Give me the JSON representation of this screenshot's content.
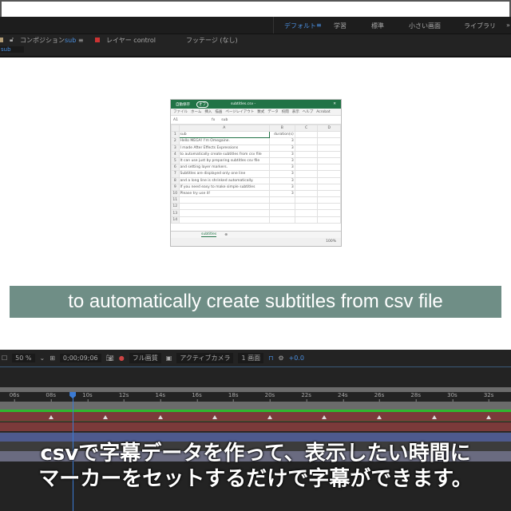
{
  "workspace": {
    "tabs": [
      "デフォルト",
      "学習",
      "標準",
      "小さい画面",
      "ライブラリ"
    ],
    "active": 0,
    "menu_icon": "≡",
    "more": "»"
  },
  "panels": {
    "composition_label": "コンポジション",
    "composition_name": "sub",
    "layer_label": "レイヤー control",
    "footage_label": "フッテージ (なし)",
    "menu_icon": "≡"
  },
  "breadcrumb": "sub",
  "excel": {
    "title": "subtitles.csv -",
    "autosave": "自動保存",
    "autosave_state": "オフ",
    "menu": [
      "ファイル",
      "ホーム",
      "挿入",
      "描画",
      "ページレイアウト",
      "数式",
      "データ",
      "校閲",
      "表示",
      "ヘルプ",
      "Acrobat"
    ],
    "cell_ref": "A1",
    "formula": "sub",
    "columns": [
      "A",
      "B",
      "C",
      "D"
    ],
    "rows": [
      [
        "sub",
        "duration(s)"
      ],
      [
        "Hello MEGA! I'm Omegaine.",
        "3"
      ],
      [
        "I made After Effects Expressions",
        "3"
      ],
      [
        "to automatically create subtitles from csv file",
        "3"
      ],
      [
        "It can use just by preparing subtitles csv file",
        "3"
      ],
      [
        "and setting layer markers.",
        "3"
      ],
      [
        "Subtitles are displayed only one line",
        "3"
      ],
      [
        "and a long line is shrinked automatically.",
        "3"
      ],
      [
        "If you need easy to make simple subtitles",
        "3"
      ],
      [
        "Please try use it!",
        "3"
      ],
      [
        "",
        ""
      ],
      [
        "",
        ""
      ],
      [
        "",
        ""
      ],
      [
        "",
        ""
      ]
    ],
    "sheet_tab": "subtitles",
    "zoom": "100%"
  },
  "viewer_subtitle": "to automatically create subtitles from csv file",
  "toolbar": {
    "zoom": "50 %",
    "timecode": "0;00;09;06",
    "quality": "フル画質",
    "camera": "アクティブカメラ",
    "views": "1 画面",
    "exposure": "+0.0"
  },
  "timeline": {
    "ruler": [
      "06s",
      "08s",
      "10s",
      "12s",
      "14s",
      "16s",
      "18s",
      "20s",
      "22s",
      "24s",
      "26s",
      "28s",
      "30s",
      "32s"
    ],
    "playhead_seconds": 9.2,
    "markers_seconds": [
      8,
      11,
      14,
      17,
      20,
      23,
      26,
      29,
      32
    ]
  },
  "caption": {
    "line1": "csvで字幕データを作って、表示したい時間に",
    "line2": "マーカーをセットするだけで字幕ができます。"
  }
}
